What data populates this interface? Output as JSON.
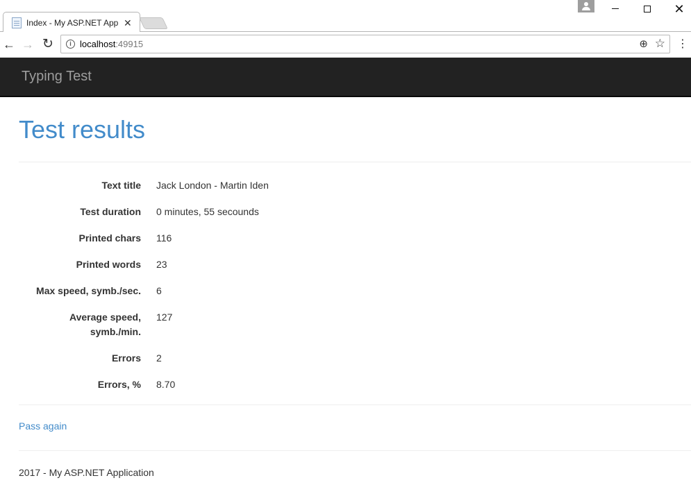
{
  "browser": {
    "tab_title": "Index - My ASP.NET App",
    "url_host": "localhost",
    "url_port": ":49915"
  },
  "navbar": {
    "brand": "Typing Test"
  },
  "page": {
    "title": "Test results",
    "details": [
      {
        "label": "Text title",
        "value": "Jack London - Martin Iden"
      },
      {
        "label": "Test duration",
        "value": "0 minutes, 55 secounds"
      },
      {
        "label": "Printed chars",
        "value": "116"
      },
      {
        "label": "Printed words",
        "value": "23"
      },
      {
        "label": "Max speed, symb./sec.",
        "value": "6"
      },
      {
        "label": "Average speed, symb./min.",
        "value": "127"
      },
      {
        "label": "Errors",
        "value": "2"
      },
      {
        "label": "Errors, %",
        "value": "8.70"
      }
    ],
    "pass_again_label": "Pass again"
  },
  "footer": {
    "text": "2017 - My ASP.NET Application"
  },
  "colors": {
    "link": "#428bca",
    "navbar_bg": "#222222",
    "brand_text": "#9d9d9d"
  }
}
